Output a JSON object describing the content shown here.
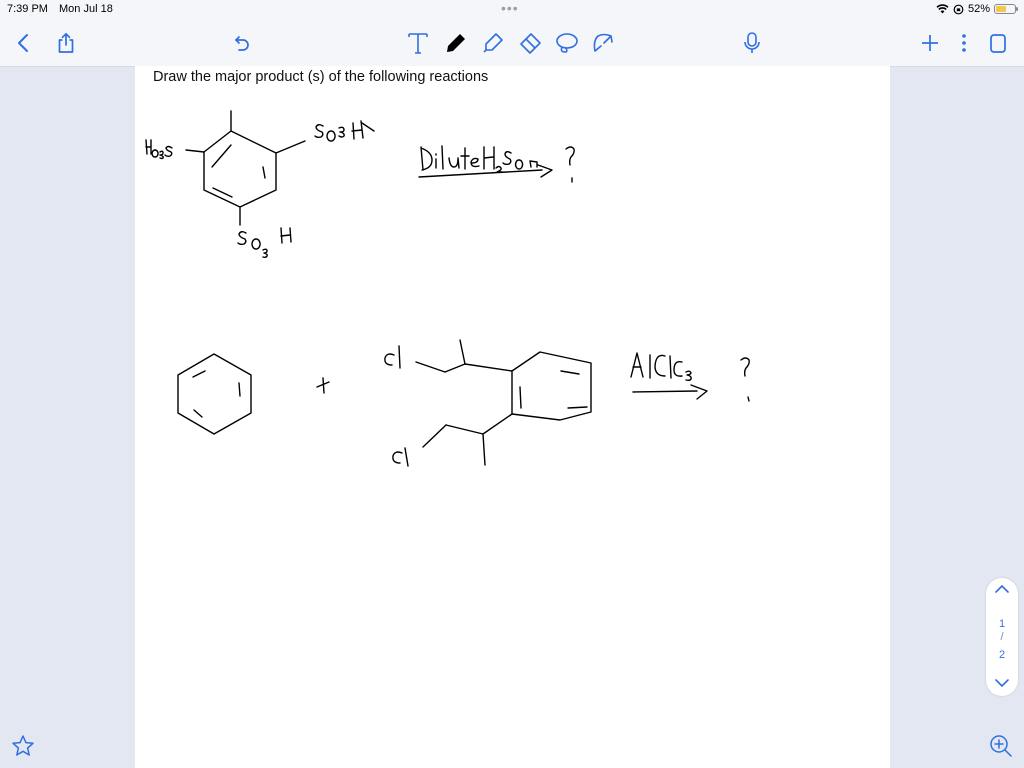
{
  "status": {
    "time": "7:39 PM",
    "date": "Mon Jul 18",
    "more": "•••",
    "battery": "52%"
  },
  "toolbar": {
    "icons": [
      "chevron-left-icon",
      "share-icon",
      "undo-icon",
      "text-tool-icon",
      "pen-icon",
      "highlighter-icon",
      "eraser-icon",
      "lasso-icon",
      "shapes-icon",
      "microphone-icon",
      "plus-icon",
      "more-vertical-icon",
      "page-view-icon"
    ]
  },
  "document": {
    "question": "Draw the major product (s) of the following reactions"
  },
  "pager": {
    "current": "1",
    "separator": "/",
    "total": "2"
  },
  "colors": {
    "accent": "#2f6fe0",
    "background": "#e3e7f1",
    "page": "#ffffff",
    "ink": "#000000"
  }
}
